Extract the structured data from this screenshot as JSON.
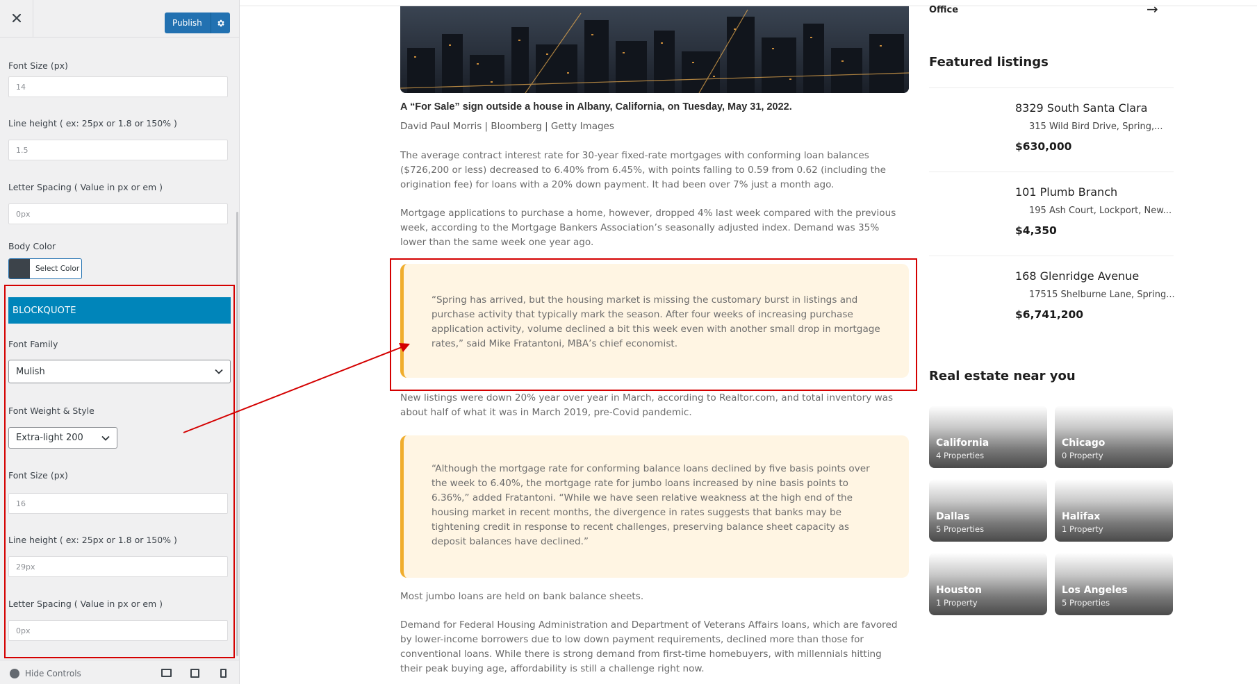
{
  "customizer": {
    "publish_label": "Publish",
    "body_fields": {
      "font_size_label": "Font Size (px)",
      "font_size_value": "14",
      "line_height_label": "Line height ( ex: 25px or 1.8 or 150% )",
      "line_height_value": "1.5",
      "letter_spacing_label": "Letter Spacing ( Value in px or em )",
      "letter_spacing_value": "0px",
      "body_color_label": "Body Color",
      "select_color_label": "Select Color",
      "body_color_value": "#3c434a"
    },
    "blockquote": {
      "section_title": "BLOCKQUOTE",
      "font_family_label": "Font Family",
      "font_family_value": "Mulish",
      "font_weight_label": "Font Weight & Style",
      "font_weight_value": "Extra-light 200",
      "font_size_label": "Font Size (px)",
      "font_size_value": "16",
      "line_height_label": "Line height ( ex: 25px or 1.8 or 150% )",
      "line_height_value": "29px",
      "letter_spacing_label": "Letter Spacing ( Value in px or em )",
      "letter_spacing_value": "0px"
    },
    "hide_controls_label": "Hide Controls"
  },
  "article": {
    "caption": "A “For Sale” sign outside a house in Albany, California, on Tuesday, May 31, 2022.",
    "credit": "David Paul Morris | Bloomberg | Getty Images",
    "para1": "The average contract interest rate for 30-year fixed-rate mortgages with conforming loan balances ($726,200 or less) decreased to 6.40% from 6.45%, with points falling to 0.59 from 0.62 (including the origination fee) for loans with a 20% down payment. It had been over 7% just a month ago.",
    "para2": "Mortgage applications to purchase a home, however, dropped 4% last week compared with the previous week, according to the Mortgage Bankers Association’s seasonally adjusted index. Demand was 35% lower than the same week one year ago.",
    "quote1": "“Spring has arrived, but the housing market is missing the customary burst in listings and purchase activity that typically mark the season. After four weeks of increasing purchase application activity, volume declined a bit this week even with another small drop in mortgage rates,” said Mike Fratantoni, MBA’s chief economist.",
    "para3": "New listings were down 20% year over year in March, according to Realtor.com, and total inventory was about half of what it was in March 2019, pre-Covid pandemic.",
    "quote2": "“Although the mortgage rate for conforming balance loans declined by five basis points over the week to 6.40%, the mortgage rate for jumbo loans increased by nine basis points to 6.36%,” added Fratantoni. “While we have seen relative weakness at the high end of the housing market in recent months, the divergence in rates suggests that banks may be tightening credit in response to recent challenges, preserving balance sheet capacity as deposit balances have declined.”",
    "para4": "Most jumbo loans are held on bank balance sheets.",
    "para5": "Demand for Federal Housing Administration and Department of Veterans Affairs loans, which are favored by lower-income borrowers due to low down payment requirements, declined more than those for conventional loans. While there is strong demand from first-time homebuyers, with millennials hitting their peak buying age, affordability is still a challenge right now."
  },
  "sidebar": {
    "office_label": "Office",
    "featured_title": "Featured listings",
    "listings": [
      {
        "name": "8329 South Santa Clara",
        "address": "315 Wild Bird Drive, Spring,...",
        "price": "$630,000"
      },
      {
        "name": "101 Plumb Branch",
        "address": "195 Ash Court, Lockport, New...",
        "price": "$4,350"
      },
      {
        "name": "168 Glenridge Avenue",
        "address": "17515 Shelburne Lane, Spring...",
        "price": "$6,741,200"
      }
    ],
    "near_title": "Real estate near you",
    "cities": [
      {
        "name": "California",
        "count": "4 Properties"
      },
      {
        "name": "Chicago",
        "count": "0 Property"
      },
      {
        "name": "Dallas",
        "count": "5 Properties"
      },
      {
        "name": "Halifax",
        "count": "1 Property"
      },
      {
        "name": "Houston",
        "count": "1 Property"
      },
      {
        "name": "Los Angeles",
        "count": "5 Properties"
      }
    ]
  },
  "colors": {
    "publish_blue": "#2271b1",
    "section_header_blue": "#0085ba",
    "annotation_red": "#d40000",
    "quote_background": "#fff5e3",
    "quote_border": "#f0ad2d"
  }
}
